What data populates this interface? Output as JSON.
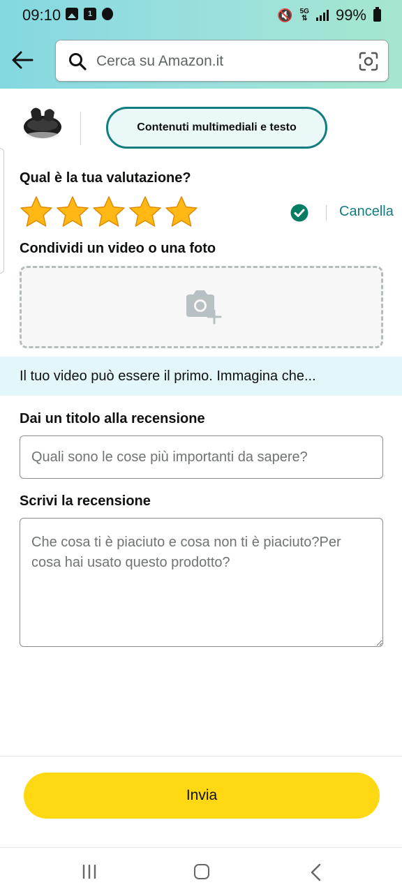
{
  "status_bar": {
    "time": "09:10",
    "calendar_day": "1",
    "network": "5G",
    "battery": "99%"
  },
  "search": {
    "placeholder": "Cerca su Amazon.it"
  },
  "tabs": {
    "active_label": "Contenuti multimediali e testo"
  },
  "rating": {
    "question": "Qual è la tua valutazione?",
    "stars_selected": 5,
    "stars_total": 5,
    "clear_label": "Cancella"
  },
  "media": {
    "title": "Condividi un video o una foto",
    "banner_text": "Il tuo video può essere il primo. Immagina che..."
  },
  "review_title": {
    "label": "Dai un titolo alla recensione",
    "placeholder": "Quali sono le cose più importanti da sapere?"
  },
  "review_body": {
    "label": "Scrivi la recensione",
    "placeholder": "Che cosa ti è piaciuto e cosa non ti è piaciuto?Per cosa hai usato questo prodotto?"
  },
  "submit": {
    "label": "Invia"
  },
  "colors": {
    "accent_teal": "#127c7e",
    "button_yellow": "#ffd814",
    "star_gold": "#ffa41c",
    "banner_bg": "#e3f6f9"
  },
  "icons": [
    "back-arrow-icon",
    "search-icon",
    "camera-lens-icon",
    "star-icon",
    "check-circle-icon",
    "camera-add-icon",
    "recent-apps-icon",
    "home-icon",
    "nav-back-icon"
  ]
}
